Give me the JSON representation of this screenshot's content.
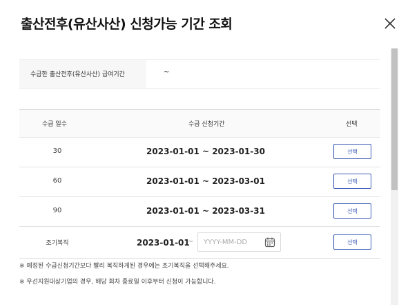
{
  "dialog": {
    "title": "출산전후(유산사산) 신청가능 기간 조회",
    "close_icon": "close-icon"
  },
  "info": {
    "label": "수급한 출산전후(유산사산) 급여기간",
    "value": "~"
  },
  "table": {
    "headers": {
      "days": "수급 일수",
      "period": "수급 신청기간",
      "select": "선택"
    },
    "rows": [
      {
        "days": "30",
        "period": "2023-01-01 ~ 2023-01-30",
        "button": "선택"
      },
      {
        "days": "60",
        "period": "2023-01-01 ~ 2023-03-01",
        "button": "선택"
      },
      {
        "days": "90",
        "period": "2023-01-01 ~ 2023-03-31",
        "button": "선택"
      }
    ],
    "early": {
      "label": "조기복직",
      "start": "2023-01-01",
      "separator": "~",
      "end_placeholder": "YYYY-MM-DD",
      "end_value": "",
      "button": "선택",
      "calendar_icon": "calendar-icon"
    }
  },
  "notes": [
    "※ 예정된 수급신청기간보다 빨리 복직하게된 경우에는 조기복직을 선택해주세요.",
    "※ 우선지원대상기업의 경우, 해당 회차 종료일 이후부터 신청이 가능합니다."
  ]
}
